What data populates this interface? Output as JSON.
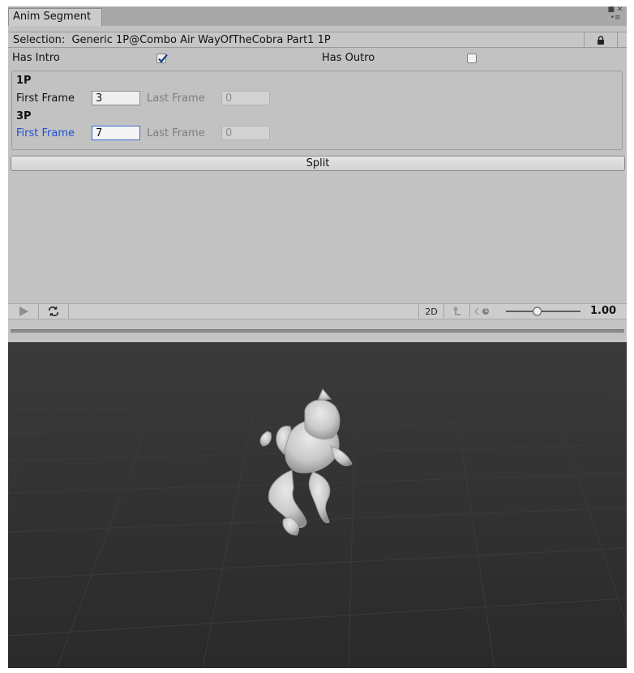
{
  "window": {
    "tab_title": "Anim Segment",
    "window_icons": "■ ✕\n•≡"
  },
  "selection": {
    "label": "Selection:",
    "value": "Generic 1P@Combo Air WayOfTheCobra Part1 1P"
  },
  "has_intro": {
    "label": "Has Intro",
    "checked": true
  },
  "has_outro": {
    "label": "Has Outro",
    "checked": false
  },
  "groups": [
    {
      "header": "1P",
      "first_frame_label": "First Frame",
      "first_frame_value": "3",
      "last_frame_label": "Last Frame",
      "last_frame_value": "0"
    },
    {
      "header": "3P",
      "first_frame_label": "First Frame",
      "first_frame_value": "7",
      "last_frame_label": "Last Frame",
      "last_frame_value": "0"
    }
  ],
  "split_button": "Split",
  "preview_toolbar": {
    "mode_2d": "2D",
    "speed_value": "1.00",
    "speed_fraction": 0.42
  },
  "colors": {
    "viewport_bg": "#2c2c2c",
    "focus_blue": "#3b6fcf",
    "label_blue": "#1f4fd8"
  }
}
